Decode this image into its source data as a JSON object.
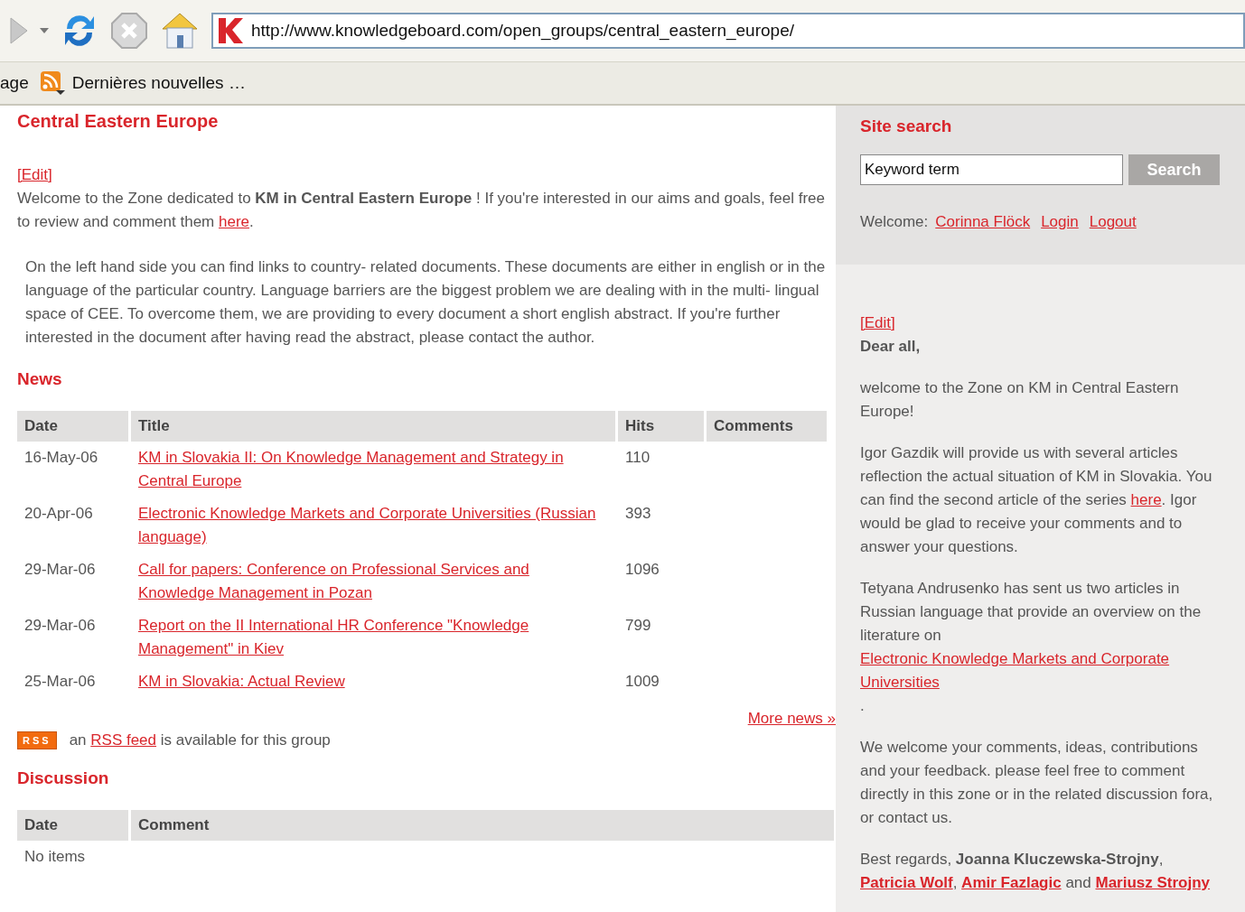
{
  "browser": {
    "address": "http://www.knowledgeboard.com/open_groups/central_eastern_europe/",
    "bookmarks": [
      {
        "label": "age",
        "feed": false
      },
      {
        "label": "Dernières nouvelles …",
        "feed": true
      }
    ]
  },
  "main": {
    "title": "Central Eastern Europe",
    "edit": "[Edit]",
    "intro": [
      {
        "kind": "text",
        "text": "Welcome to the Zone dedicated to "
      },
      {
        "kind": "bold",
        "text": "KM in Central Eastern Europe"
      },
      {
        "kind": "text",
        "text": " ! If you're interested in our aims and goals, feel free to review and comment them "
      },
      {
        "kind": "link",
        "text": "here"
      },
      {
        "kind": "text",
        "text": "."
      }
    ],
    "body": "On the left hand side you can find links to country- related documents. These documents are either in english or in the language of the particular country. Language barriers are the biggest problem we are dealing with in the multi- lingual space of CEE. To overcome them, we are providing to every document a short english abstract. If you're further interested in the document after having read the abstract, please contact the author.",
    "news": {
      "heading": "News",
      "columns": [
        "Date",
        "Title",
        "Hits",
        "Comments"
      ],
      "rows": [
        {
          "date": "16-May-06",
          "title": "KM in Slovakia II: On Knowledge Management and Strategy in Central Europe",
          "hits": "110"
        },
        {
          "date": "20-Apr-06",
          "title": "Electronic Knowledge Markets and Corporate Universities (Russian language)",
          "hits": "393"
        },
        {
          "date": "29-Mar-06",
          "title": "Call for papers: Conference on Professional Services and Knowledge Management in Pozan",
          "hits": "1096"
        },
        {
          "date": "29-Mar-06",
          "title": "Report on the II International HR Conference \"Knowledge Management\" in Kiev",
          "hits": "799"
        },
        {
          "date": "25-Mar-06",
          "title": "KM in Slovakia: Actual Review",
          "hits": "1009"
        }
      ],
      "more": "More news »"
    },
    "rss": {
      "badge": "RSS",
      "text": [
        {
          "kind": "text",
          "text": "an "
        },
        {
          "kind": "link",
          "text": "RSS feed"
        },
        {
          "kind": "text",
          "text": " is available for this group"
        }
      ]
    },
    "discussion": {
      "heading": "Discussion",
      "columns": [
        "Date",
        "Comment"
      ],
      "empty": "No items"
    }
  },
  "sidebar": {
    "search": {
      "heading": "Site search",
      "value": "Keyword term",
      "button": "Search"
    },
    "welcome": {
      "label": "Welcome:",
      "links": [
        "Corinna Flöck",
        "Login",
        "Logout"
      ]
    },
    "edit": "[Edit]",
    "paragraphs": [
      [
        {
          "kind": "bold",
          "text": "Dear all,"
        }
      ],
      [
        {
          "kind": "text",
          "text": "welcome to the Zone on KM in Central Eastern Europe!"
        }
      ],
      [
        {
          "kind": "text",
          "text": "Igor Gazdik will provide us with several articles reflection the actual situation of KM in Slovakia. You can find the second article of the series "
        },
        {
          "kind": "link",
          "text": "here"
        },
        {
          "kind": "text",
          "text": ". Igor would be glad to receive your comments and to answer your questions."
        }
      ],
      [
        {
          "kind": "text",
          "text": "Tetyana Andrusenko has sent us two articles in Russian language that provide an overview on the literature on "
        },
        {
          "kind": "link",
          "text": "Electronic Knowledge Markets and Corporate Universities"
        },
        {
          "kind": "text",
          "text": "."
        }
      ],
      [
        {
          "kind": "text",
          "text": "We welcome your comments, ideas, contributions and your feedback. please feel free to comment directly in this zone or in the related discussion fora, or contact us."
        }
      ],
      [
        {
          "kind": "text",
          "text": "Best regards, "
        },
        {
          "kind": "bold",
          "text": "Joanna Kluczewska-Strojny"
        },
        {
          "kind": "text",
          "text": ", "
        },
        {
          "kind": "bold_link",
          "text": "Patricia Wolf"
        },
        {
          "kind": "text",
          "text": ", "
        },
        {
          "kind": "bold_link",
          "text": "Amir Fazlagic"
        },
        {
          "kind": "text",
          "text": " and "
        },
        {
          "kind": "bold_link",
          "text": "Mariusz Strojny"
        }
      ]
    ]
  }
}
